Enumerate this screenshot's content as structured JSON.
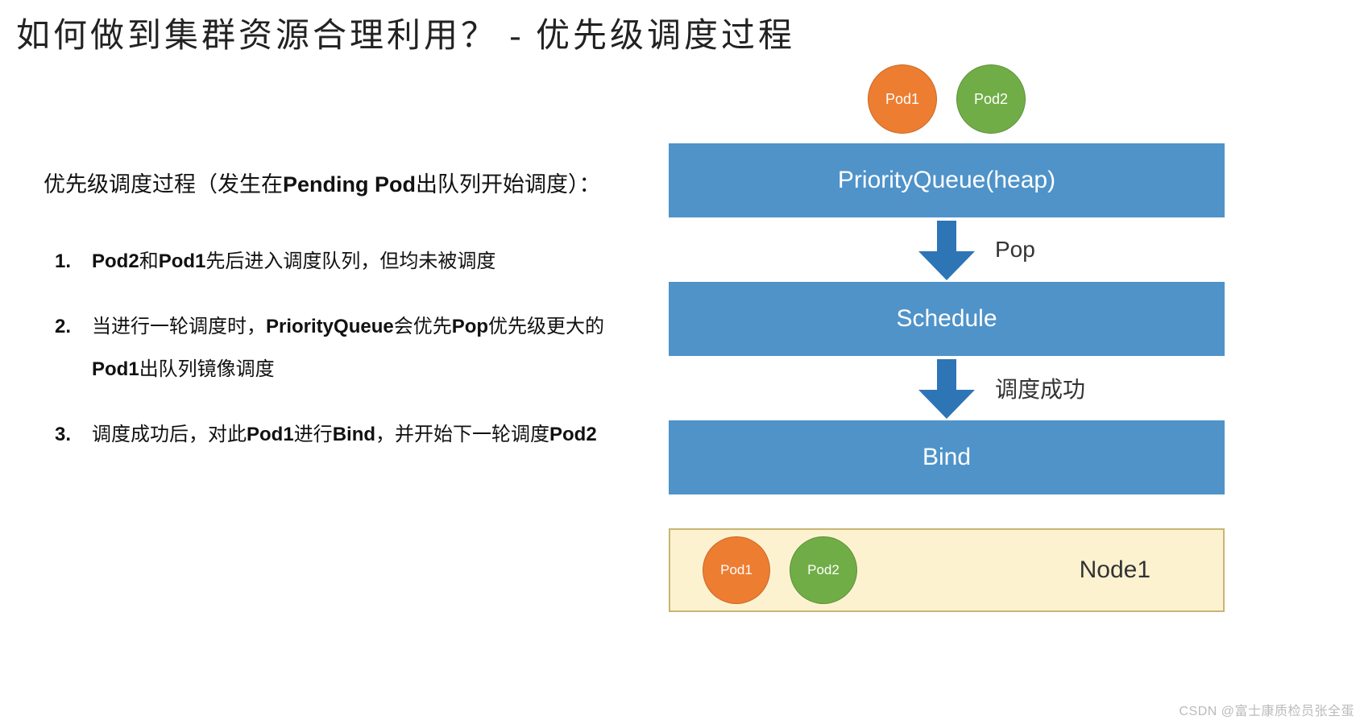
{
  "title": "如何做到集群资源合理利用？ - 优先级调度过程",
  "left": {
    "lead_pre": "优先级调度过程（发生在",
    "lead_bold1": "Pending Pod",
    "lead_post": "出队列开始调度）：",
    "steps": {
      "s1a": "Pod2",
      "s1b": "和",
      "s1c": "Pod1",
      "s1d": "先后进入调度队列，但均未被调度",
      "s2a": "当进行一轮调度时，",
      "s2b": "PriorityQueue",
      "s2c": "会优先",
      "s2d": "Pop",
      "s2e": "优先级更大的",
      "s2f": "Pod1",
      "s2g": "出队列镜像调度",
      "s3a": "调度成功后，对此",
      "s3b": "Pod1",
      "s3c": "进行",
      "s3d": "Bind",
      "s3e": "，并开始下一轮调度",
      "s3f": "Pod2"
    }
  },
  "diagram": {
    "pod1": "Pod1",
    "pod2": "Pod2",
    "stage1": "PriorityQueue(heap)",
    "label1": "Pop",
    "stage2": "Schedule",
    "label2": "调度成功",
    "stage3": "Bind",
    "node_pod1": "Pod1",
    "node_pod2": "Pod2",
    "node_label": "Node1"
  },
  "watermark": "CSDN @富士康质检员张全蛋"
}
